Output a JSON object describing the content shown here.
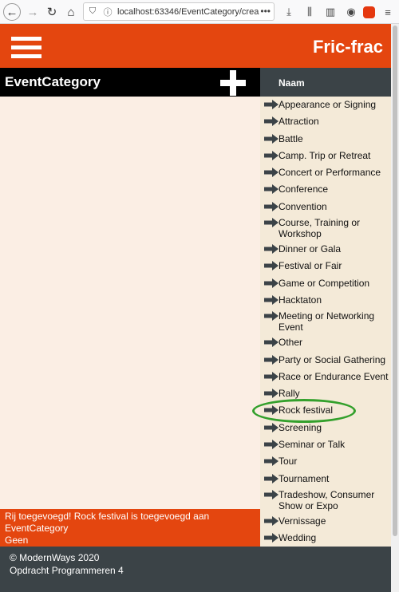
{
  "browser": {
    "url": "localhost:63346/EventCategory/crea",
    "more": "•••",
    "icons": [
      "back-icon",
      "forward-icon",
      "reload-icon",
      "home-icon",
      "shield-icon",
      "info-icon",
      "download-icon",
      "library-icon",
      "sidebar-icon",
      "account-icon",
      "extension-icon",
      "menu-icon"
    ]
  },
  "header": {
    "title": "Fric-frac"
  },
  "left_pane": {
    "title": "EventCategory",
    "feedback": {
      "line1": "Rij toegevoegd! Rock festival is toegevoegd aan",
      "line2": "EventCategory",
      "line3": "Geen"
    }
  },
  "right_pane": {
    "column_header": "Naam",
    "items": [
      [
        "Appearance or Signing"
      ],
      [
        "Attraction"
      ],
      [
        "Battle"
      ],
      [
        "Camp. Trip or Retreat"
      ],
      [
        "Concert or Performance"
      ],
      [
        "Conference"
      ],
      [
        "Convention"
      ],
      [
        "Course, Training or",
        "Workshop"
      ],
      [
        "Dinner or Gala"
      ],
      [
        "Festival or Fair"
      ],
      [
        "Game or Competition"
      ],
      [
        "Hacktaton"
      ],
      [
        "Meeting or Networking",
        "Event"
      ],
      [
        "Other"
      ],
      [
        "Party or Social Gathering"
      ],
      [
        "Race or Endurance Event"
      ],
      [
        "Rally"
      ],
      [
        "Rock festival"
      ],
      [
        "Screening"
      ],
      [
        "Seminar or Talk"
      ],
      [
        "Tour"
      ],
      [
        "Tournament"
      ],
      [
        "Tradeshow, Consumer",
        "Show or Expo"
      ],
      [
        "Vernissage"
      ],
      [
        "Wedding"
      ]
    ],
    "highlighted_item": "Rock festival"
  },
  "footer": {
    "line1": "© ModernWays 2020",
    "line2": "Opdracht Programmeren 4"
  },
  "colors": {
    "accent": "#e4460f",
    "dark": "#3b4347",
    "highlight": "#33a02c",
    "annotation": "#e53935"
  }
}
